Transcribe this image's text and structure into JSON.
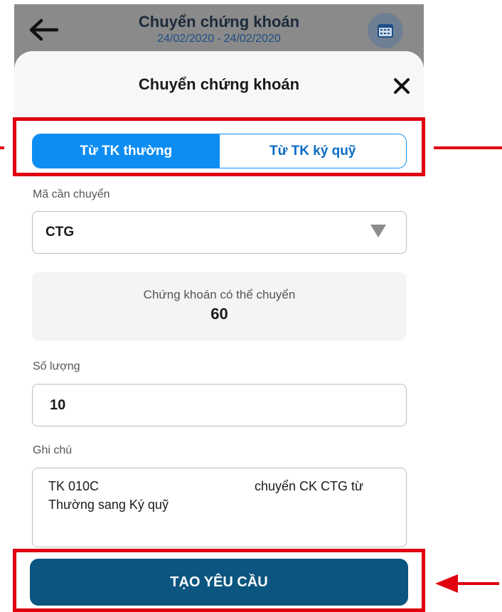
{
  "header": {
    "title": "Chuyển chứng khoán",
    "date_from": "24/02/2020",
    "date_separator": "-",
    "date_to": "24/02/2020",
    "back_icon": "arrow-left-icon",
    "calendar_icon": "calendar-icon"
  },
  "sheet": {
    "title": "Chuyển chứng khoán",
    "close_icon": "close-icon",
    "tabs": [
      {
        "label": "Từ TK thường",
        "active": true
      },
      {
        "label": "Từ TK ký quỹ",
        "active": false
      }
    ],
    "stock_code": {
      "label": "Mã cần chuyển",
      "value": "CTG"
    },
    "available": {
      "label": "Chứng khoán có thể chuyển",
      "value": "60"
    },
    "quantity": {
      "label": "Số lượng",
      "value": "10"
    },
    "note": {
      "label": "Ghi chú",
      "line1_left": "TK 010C",
      "line1_right": "chuyển CK CTG từ",
      "line2": "Thường sang Ký quỹ"
    },
    "submit_label": "TẠO YÊU CẦU"
  },
  "colors": {
    "accent": "#0d8df2",
    "button": "#0b5580",
    "highlight": "#e0000f"
  }
}
